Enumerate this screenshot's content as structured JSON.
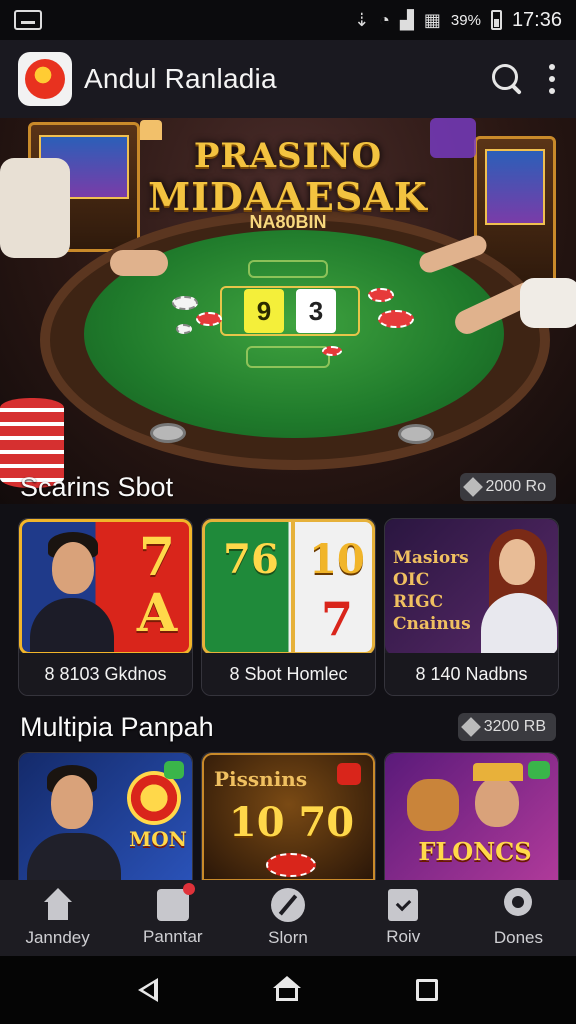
{
  "status_bar": {
    "battery_percent": "39%",
    "time": "17:36"
  },
  "app_bar": {
    "title": "Andul Ranladia"
  },
  "hero": {
    "title_line1": "PRASINO",
    "title_line2": "MIDAAESAK",
    "subtitle": "NA80BIN",
    "cards": [
      "9",
      "3"
    ]
  },
  "sections": [
    {
      "title": "Scarins Sbot",
      "badge": "2000 Ro",
      "tiles": [
        {
          "caption": "8 8103 Gkdnos",
          "art": "7 A"
        },
        {
          "caption": "8 Sbot Homlec",
          "art_left": "76",
          "art_right": "10",
          "art_bottom": "7"
        },
        {
          "caption": "8 140 Nadbns",
          "art": "Masiors OIC RIGC Cnainus"
        }
      ]
    },
    {
      "title": "Multipia Panpah",
      "badge": "3200 RB",
      "tiles": [
        {
          "art": "MON"
        },
        {
          "art_top": "Pissnins",
          "art": "10 70"
        },
        {
          "art": "FLONCS"
        }
      ]
    }
  ],
  "bottom_nav": [
    {
      "label": "Janndey",
      "icon": "home-icon"
    },
    {
      "label": "Panntar",
      "icon": "puzzle-icon"
    },
    {
      "label": "Slorn",
      "icon": "slot-icon"
    },
    {
      "label": "Roiv",
      "icon": "bookmark-icon"
    },
    {
      "label": "Dones",
      "icon": "user-icon"
    }
  ]
}
